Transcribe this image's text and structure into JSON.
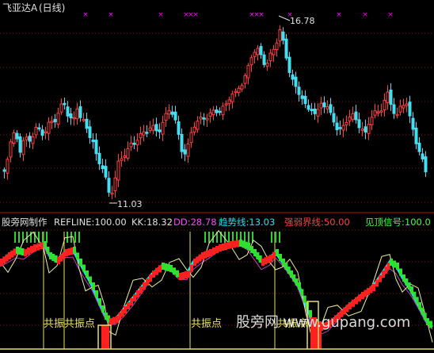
{
  "header": {
    "title": "飞亚达A",
    "period": "(日线)",
    "markers_color": "#ff00ff"
  },
  "price_chart": {
    "high_label": "16.78",
    "low_label": "11.03",
    "up_color": "#ff4040",
    "down_color": "#40e0f0"
  },
  "indicator_bar": {
    "name": "股旁网制作",
    "refline": "REFLINE:100.00",
    "kk": "KK:18.32",
    "dd": "DD:28.78",
    "trend": "趋势线:13.03",
    "strength": "强弱界线:50.00",
    "top_signal": "见顶信号:100.0"
  },
  "indicator_chart": {
    "resonance_labels": [
      "共振共振点",
      "共振点",
      "共振点"
    ],
    "watermark": "股旁网 www.gupang.com"
  }
}
